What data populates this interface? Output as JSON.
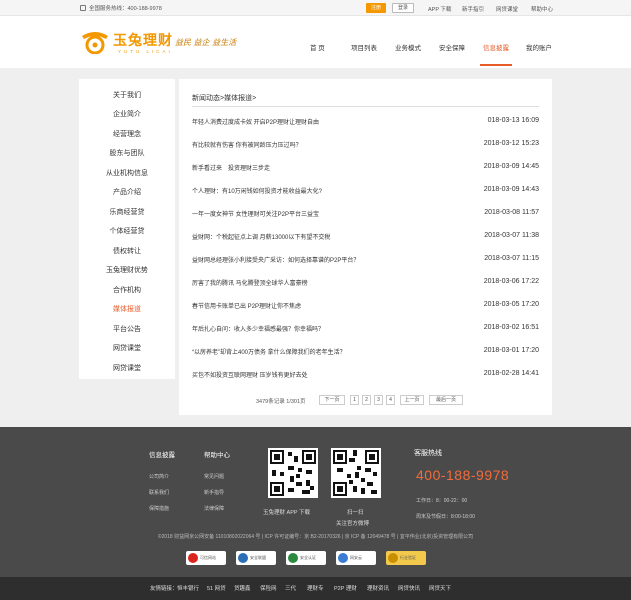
{
  "topbar": {
    "hotline": "全国服务热线：400-188-9978",
    "register": "注册",
    "login": "登录",
    "links": [
      "APP 下载",
      "新手指引",
      "网贷课堂",
      "帮助中心"
    ]
  },
  "header": {
    "logo_cn": "玉兔理财",
    "logo_en": "YUTU LICAI",
    "slogan": "益民 益企 益生活",
    "nav": [
      "首 页",
      "项目列表",
      "业务模式",
      "安全保障",
      "信息披露",
      "我的账户"
    ],
    "active_nav": "信息披露"
  },
  "sidebar": {
    "items": [
      "关于我们",
      "企业简介",
      "经营理念",
      "股东与团队",
      "从业机构信息",
      "产品介绍",
      "乐商经营贷",
      "个体经营贷",
      "债权转让",
      "玉兔理财优势",
      "合作机构",
      "媒体报道",
      "平台公告",
      "网贷课堂",
      "网贷课堂"
    ],
    "active": "媒体报道"
  },
  "main": {
    "breadcrumb": "新闻动态>媒体报道>",
    "articles": [
      {
        "title": "年轻人消费过度成卡奴 开启P2P理财让理财自由",
        "date": "018-03-13 16:09"
      },
      {
        "title": "有比较就有伤害 你有被同龄压力压过吗？",
        "date": "2018-03-12 15:23"
      },
      {
        "title": "新手看过来　投资理财三步走",
        "date": "2018-03-09 14:45"
      },
      {
        "title": "个人理财：有10万闲钱如何投资才能收益最大化?",
        "date": "2018-03-09 14:43"
      },
      {
        "title": "一年一度女神节 女性理财可关注P2P平台三益宝",
        "date": "2018-03-08 11:57"
      },
      {
        "title": "益财网：个税起征点上调 月薪13000以下有望不交税",
        "date": "2018-03-07 11:38"
      },
      {
        "title": "益财网总经理张小利接受央广采访：如何选择靠谱的P2P平台？",
        "date": "2018-03-07 11:15"
      },
      {
        "title": "厉害了我的腾讯 马化腾登顶全球华人富豪榜",
        "date": "2018-03-06 17:22"
      },
      {
        "title": "春节信用卡账单已出 P2P理财让你不焦虑",
        "date": "2018-03-05 17:20"
      },
      {
        "title": "年后扎心自问：收入多少幸福感最强？你幸福吗？",
        "date": "2018-03-02 16:51"
      },
      {
        "title": "“以房养老”却背上400万债务 拿什么保障我们的老年生活？",
        "date": "2018-03-01 17:20"
      },
      {
        "title": "买包不如投资互联网理财 压岁钱有更好去处",
        "date": "2018-02-28 14:41"
      }
    ],
    "pager": {
      "count": "3479条记录 1/301页",
      "next": "下一页",
      "pages": [
        "1",
        "2",
        "3",
        "4"
      ],
      "prev": "上一页",
      "last": "最后一页"
    }
  },
  "footer": {
    "col1_title": "信息披露",
    "col1_links": [
      "公司简介",
      "联系我们",
      "保障措施"
    ],
    "col2_title": "帮助中心",
    "col2_links": [
      "常见问题",
      "新手指导",
      "法律保障"
    ],
    "qr1_caption": "玉兔理财 APP 下载",
    "qr2_caption_1": "扫一扫",
    "qr2_caption_2": "关注官方微博",
    "hotline_title": "客服热线",
    "hotline_number": "400-188-9978",
    "worktime_1": "工作日：8：00-22：00",
    "worktime_2": "周末及节假日：8:00-18:00",
    "copyright": "©2018 财益网京公网安备 11010802022064 号 | ICP 许可证编号：京 B2-20170326 | 京 ICP 备 12049478 号 | 宜平伟业(北京)投资管理有限公司",
    "badges": [
      "可信网站",
      "安全联盟",
      "安全认证",
      "网安云",
      "行业验证"
    ],
    "friend_links": [
      "友情链接：",
      "恒丰银行",
      "51 网贷",
      "贷趣鑫",
      "保险网",
      "三代",
      "理财专",
      "P2P 理财",
      "理财资讯",
      "网贷快讯",
      "网贷天下"
    ]
  },
  "colors": {
    "accent": "#f39800",
    "active": "#e85c2b",
    "hotline": "#f36b3b",
    "footer_bg": "#4a4a4a"
  }
}
